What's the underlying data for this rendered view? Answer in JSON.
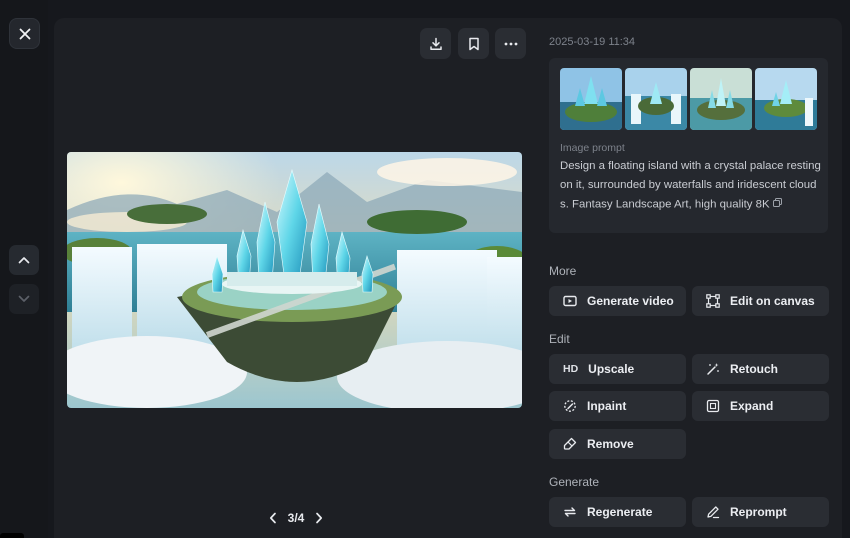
{
  "viewer": {
    "timestamp": "2025-03-19 11:34",
    "pager": {
      "current": "3/4"
    }
  },
  "prompt": {
    "label": "Image prompt",
    "text": "Design a floating island with a crystal palace resting on it, surrounded by waterfalls and iridescent clouds. Fantasy Landscape Art, high quality 8K"
  },
  "sections": {
    "more": "More",
    "edit": "Edit",
    "generate": "Generate"
  },
  "actions": {
    "generate_video": "Generate video",
    "edit_on_canvas": "Edit on canvas",
    "upscale": "Upscale",
    "upscale_badge": "HD",
    "retouch": "Retouch",
    "inpaint": "Inpaint",
    "expand": "Expand",
    "remove": "Remove",
    "regenerate": "Regenerate",
    "reprompt": "Reprompt"
  },
  "colors": {
    "background": "#16181d",
    "panel": "#1d1f24",
    "button": "#2a2d33",
    "muted_text": "#7d828b"
  },
  "icons": [
    "close-icon",
    "chevron-up-icon",
    "chevron-down-icon",
    "download-icon",
    "bookmark-icon",
    "more-icon",
    "copy-icon",
    "video-icon",
    "canvas-icon",
    "retouch-icon",
    "inpaint-icon",
    "expand-icon",
    "eraser-icon",
    "regenerate-icon",
    "pencil-icon",
    "chevron-left-icon",
    "chevron-right-icon"
  ]
}
